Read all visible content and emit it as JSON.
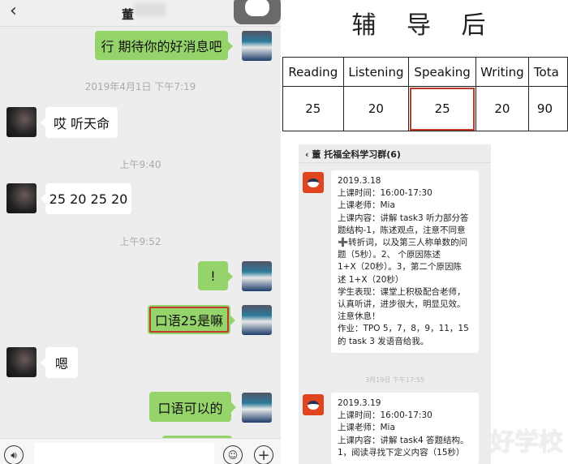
{
  "left_chat": {
    "back_icon": "chevron-left",
    "contact_name": "董",
    "messages": [
      {
        "side": "right",
        "text": "行 期待你的好消息吧"
      },
      {
        "type": "timestamp",
        "text": "2019年4月1日 下午7:19"
      },
      {
        "side": "left",
        "text": "哎 听天命"
      },
      {
        "type": "timestamp",
        "text": "上午9:40"
      },
      {
        "side": "left",
        "text": "25 20 25 20"
      },
      {
        "type": "timestamp",
        "text": "上午9:52"
      },
      {
        "side": "right",
        "text": "!"
      },
      {
        "side": "right",
        "text": "口语25是嘛",
        "highlighted": true
      },
      {
        "side": "left",
        "text": "嗯"
      },
      {
        "side": "right",
        "text": "口语可以的"
      }
    ],
    "input_bar": {
      "voice_icon": "voice",
      "emoji_icon": "emoji",
      "plus_icon": "plus"
    },
    "colors": {
      "sent_bubble": "#95d46a",
      "highlight": "#c0392b"
    }
  },
  "right_panel": {
    "title": "辅 导 后",
    "scores": {
      "headers": [
        "Reading",
        "Listening",
        "Speaking",
        "Writing",
        "Tota"
      ],
      "values": [
        "25",
        "20",
        "25",
        "20",
        "90"
      ],
      "highlighted_column": "Speaking"
    },
    "group_chat": {
      "title": "董 托福全科学习群(6)",
      "messages": [
        {
          "lines": [
            "2019.3.18",
            "上课时间：16:00-17:30",
            "上课老师：Mia",
            "上课内容：讲解 task3 听力部分答",
            "题结构-1，陈述观点，注意不同意",
            "➕转折词，以及第三人称单数的问",
            "题（5秒）。2、     个原因陈述",
            "1+X（20秒）。3，第二个原因陈",
            "述 1+X（20秒）",
            "学生表现：课堂上积极配合老师，",
            "认真听讲，进步很大，明显见效。",
            "注意休息！",
            "作业：TPO 5，7，8，9，11，15",
            "的 task 3 发语音给我。"
          ]
        },
        {
          "timestamp": "3月19日 下午17:55"
        },
        {
          "lines": [
            "2019.3.19",
            "上课时间：16:00-17:30",
            "上课老师：Mia",
            "上课内容：讲解 task4 答题结构。",
            "1，阅读寻找下定义内容（15秒）"
          ]
        }
      ]
    },
    "watermark": "好学校"
  }
}
